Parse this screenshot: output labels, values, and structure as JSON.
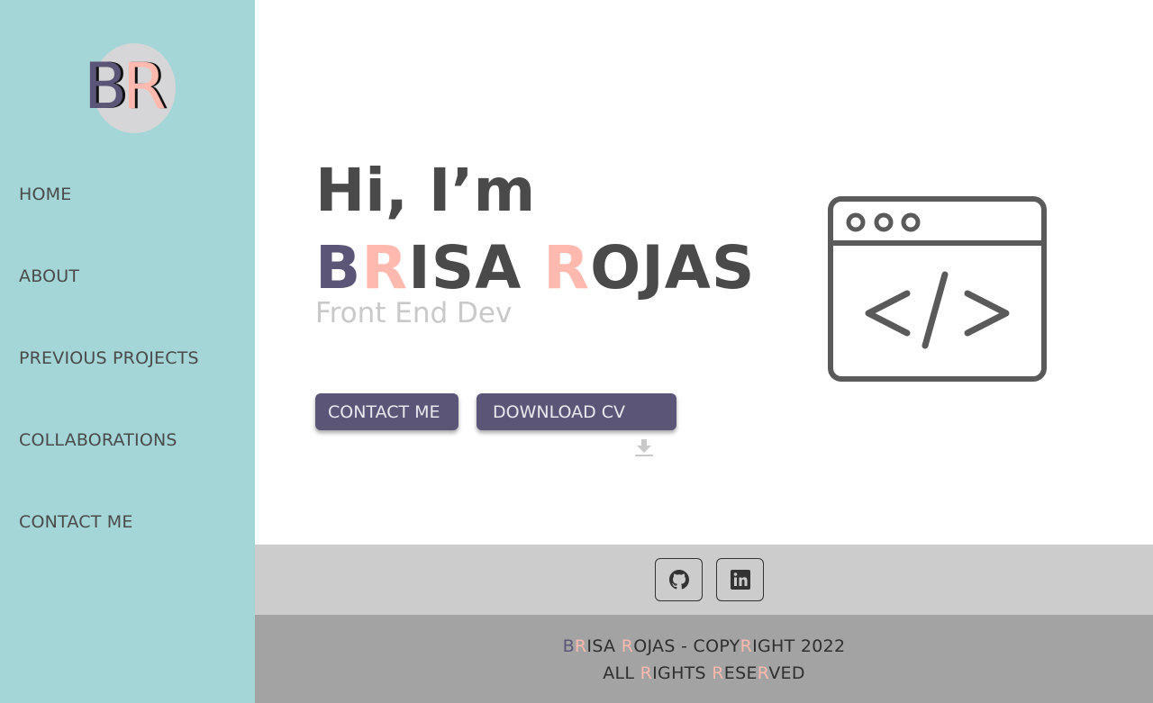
{
  "logo": {
    "letter1": "B",
    "letter2": "R"
  },
  "nav": {
    "items": [
      {
        "label": "HOME"
      },
      {
        "label": "ABOUT"
      },
      {
        "label": "PREVIOUS PROJECTS"
      },
      {
        "label": "COLLABORATIONS"
      },
      {
        "label": "CONTACT ME"
      }
    ]
  },
  "hero": {
    "greeting": "Hi, I’m",
    "name": {
      "b": "B",
      "r1": "R",
      "isa": "ISA ",
      "r2": "R",
      "ojas": "OJAS"
    },
    "subtitle": "Front End Dev",
    "contact_button": "CONTACT ME",
    "download_button": "DOWNLOAD CV"
  },
  "icons": {
    "download": "download-icon",
    "code_window": "code-window-icon",
    "github": "github-icon",
    "linkedin": "linkedin-icon"
  },
  "footer": {
    "line1": {
      "b": "B",
      "r": "R",
      "isa": "ISA ",
      "r2": "R",
      "ojas_copy": "OJAS - COPY",
      "r3": "R",
      "ight": "IGHT 2022"
    },
    "line2": {
      "all": "ALL ",
      "r": "R",
      "ights": "IGHTS ",
      "r2": "R",
      "ese": "ESE",
      "r3": "R",
      "ved": "VED"
    }
  },
  "colors": {
    "sidebar_bg": "#a4d6d7",
    "accent_purple": "#5b5677",
    "accent_pink": "#ffb9ae",
    "social_bar_bg": "#cccccc",
    "footer_bg": "#a3a3a3"
  }
}
